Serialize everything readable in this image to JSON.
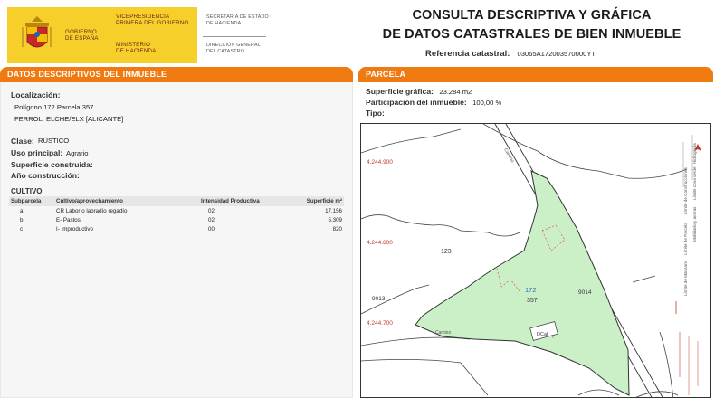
{
  "header": {
    "gobierno": [
      "GOBIERNO",
      "DE ESPAÑA"
    ],
    "vicepresidencia": [
      "VICEPRESIDENCIA",
      "PRIMERA DEL GOBIERNO"
    ],
    "ministerio": [
      "MINISTERIO",
      "DE HACIENDA"
    ],
    "secretaria": [
      "SECRETARÍA DE ESTADO",
      "DE HACIENDA"
    ],
    "direccion": [
      "DIRECCIÓN GENERAL",
      "DEL CATASTRO"
    ],
    "title_line1": "CONSULTA DESCRIPTIVA Y GRÁFICA",
    "title_line2": "DE DATOS CATASTRALES DE BIEN INMUEBLE",
    "ref_label": "Referencia catastral:",
    "ref_value": "03065A172003570000YT"
  },
  "left": {
    "bar_title": "DATOS DESCRIPTIVOS DEL INMUEBLE",
    "localizacion_label": "Localización:",
    "localizacion_line1": "Polígono 172 Parcela 357",
    "localizacion_line2": "FERROL. ELCHE/ELX [ALICANTE]",
    "clase_label": "Clase:",
    "clase_value": "RÚSTICO",
    "uso_label": "Uso principal:",
    "uso_value": "Agrario",
    "sup_label": "Superficie construida:",
    "anio_label": "Año construcción:",
    "cultivo_label": "CULTIVO",
    "cultivo_headers": [
      "Subparcela",
      "Cultivo/aprovechamiento",
      "Intensidad Productiva",
      "Superficie m²"
    ],
    "cultivo_rows": [
      [
        "a",
        "CR Labor o labradío regadío",
        "02",
        "17.156"
      ],
      [
        "b",
        "E- Pastos",
        "02",
        "5.309"
      ],
      [
        "c",
        "I- Improductivo",
        "00",
        "820"
      ]
    ]
  },
  "right": {
    "bar_title": "PARCELA",
    "superficie_label": "Superficie gráfica:",
    "superficie_value": "23.284 m2",
    "participacion_label": "Participación del inmueble:",
    "participacion_value": "100,00 %",
    "tipo_label": "Tipo:",
    "map": {
      "coord_labels": [
        "4.244.900",
        "4.244.800",
        "4.244.700"
      ],
      "parcel_labels": [
        "123",
        "172",
        "357",
        "9013",
        "9014",
        "DCaI"
      ],
      "road_labels": [
        "Camino",
        "Camino"
      ],
      "legend_items": [
        "Límite de Manzana",
        "Límite de Parcela",
        "Límite de Construcciones",
        "Mobiliario y aceras",
        "Límite zona verde",
        "Hidrografía"
      ],
      "fill_color": "#cbf0c8",
      "line_color": "#333333",
      "accent_color": "#d9534f"
    }
  },
  "colors": {
    "orange": "#ef7a12",
    "gov_yellow": "#f6cf2b"
  }
}
